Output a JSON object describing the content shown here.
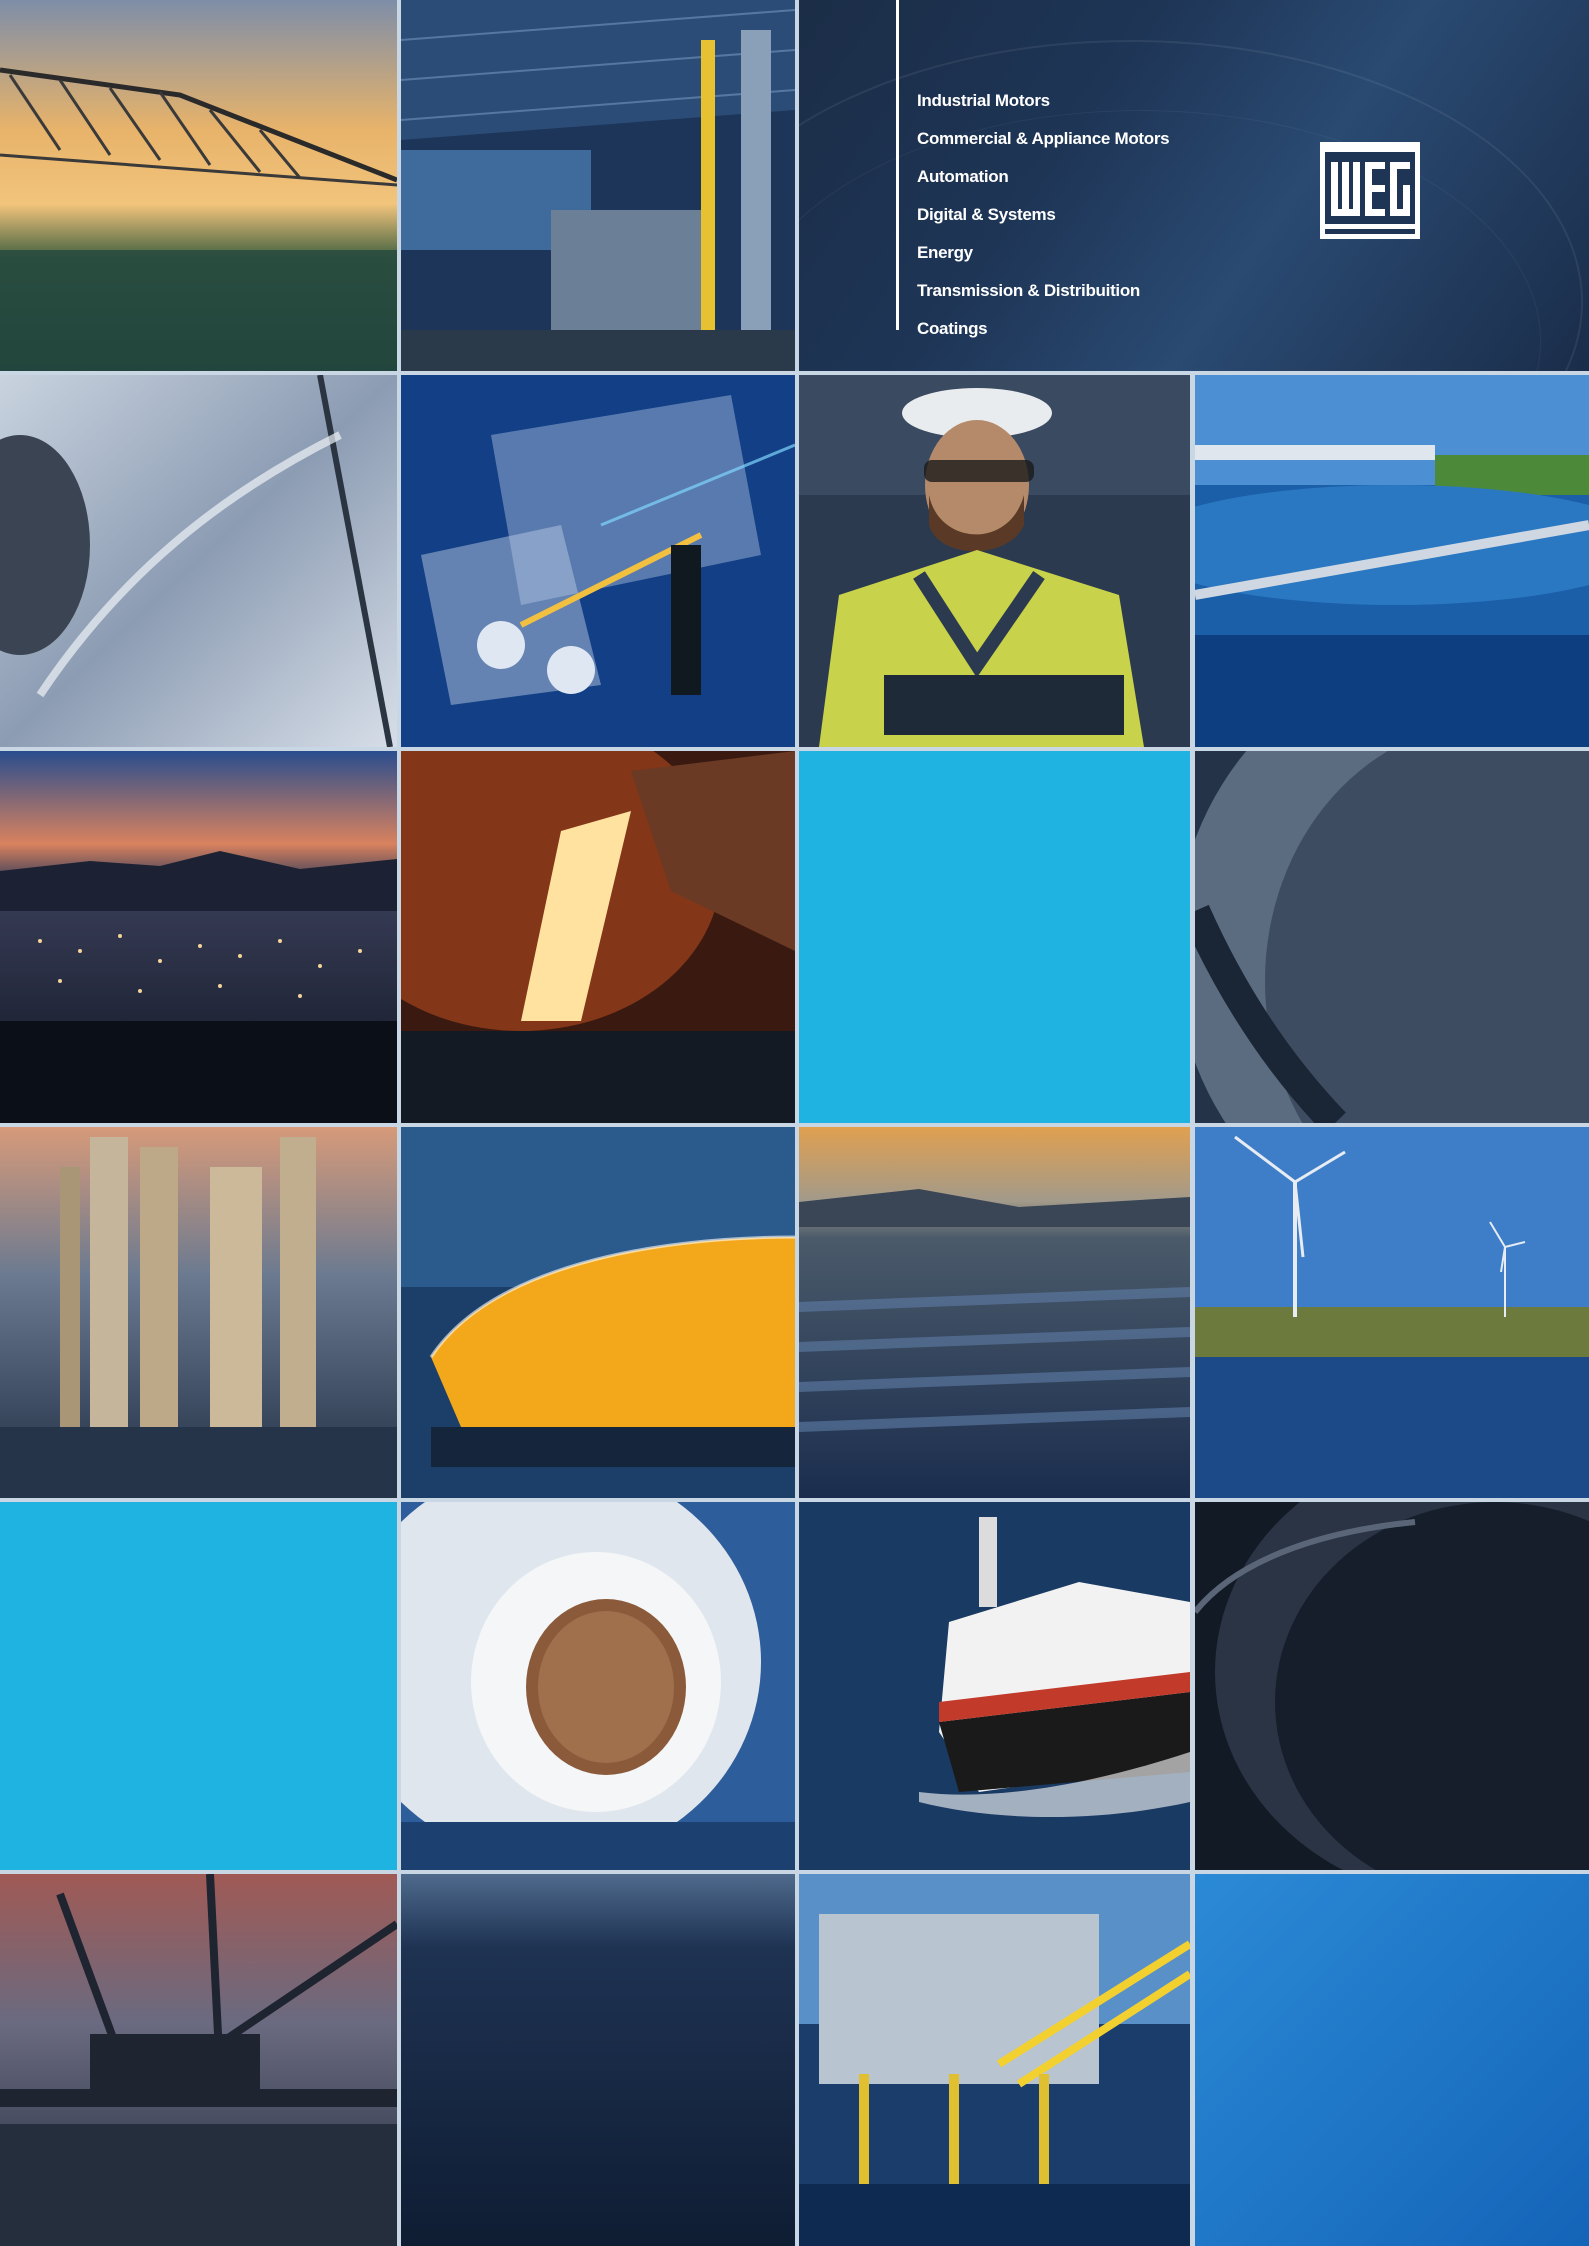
{
  "brand": {
    "logo_text": "WEG"
  },
  "header": {
    "categories": [
      "Industrial Motors",
      "Commercial & Appliance Motors",
      "Automation",
      "Digital & Systems",
      "Energy",
      "Transmission & Distribuition",
      "Coatings"
    ]
  },
  "colors": {
    "accent_cyan": "#1eb3e0",
    "navy": "#1b2d47",
    "blue": "#1e6fc1"
  },
  "tiles": [
    "irrigation-pivot-photo",
    "steel-factory-photo",
    "metal-sheet-photo",
    "electric-truck-photo",
    "engineer-tablet-photo",
    "water-treatment-photo",
    "city-night-photo",
    "molten-steel-photo",
    "cyan-tile",
    "pipe-interior-photo",
    "refinery-towers-photo",
    "bottling-line-photo",
    "solar-farm-photo",
    "wind-turbines-photo",
    "cyan-tile",
    "paper-roll-photo",
    "ship-photo",
    "dark-pipe-photo",
    "mining-excavator-photo",
    "dark-blue-tile",
    "offshore-platform-photo",
    "blue-tile"
  ]
}
